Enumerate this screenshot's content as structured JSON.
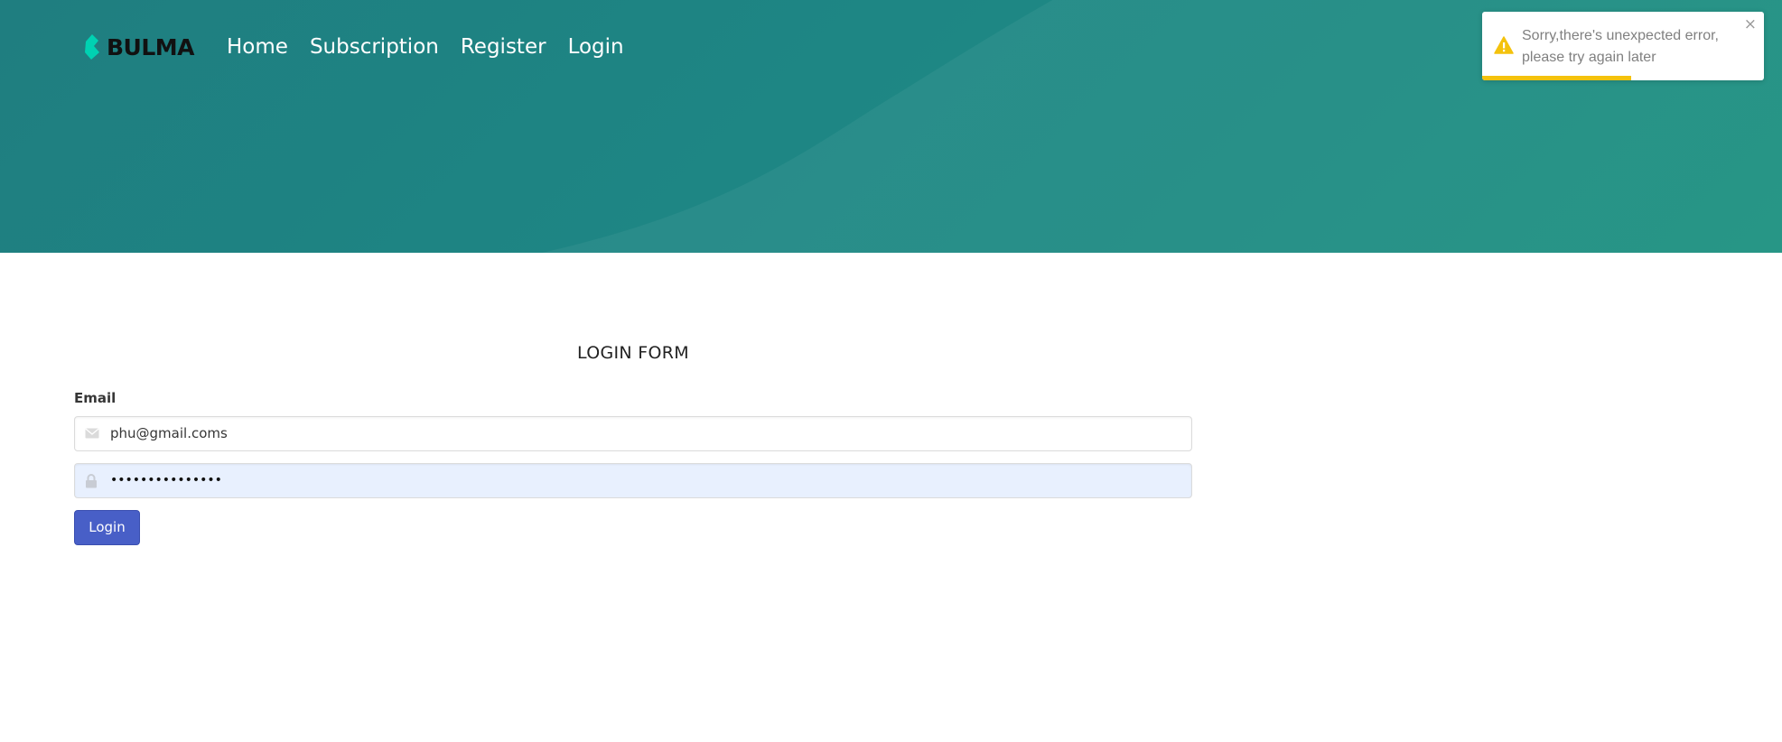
{
  "navbar": {
    "brand": "BULMA",
    "links": [
      "Home",
      "Subscription",
      "Register",
      "Login"
    ]
  },
  "toast": {
    "message": "Sorry,there's unexpected error, please try again later",
    "close": "×",
    "icon": "warning-icon",
    "progress": 0.53,
    "accent": "#f4c20d"
  },
  "form": {
    "title": "LOGIN FORM",
    "email_label": "Email",
    "email_value": "phu@gmail.coms",
    "email_icon": "envelope-icon",
    "password_value": "•••••••••••••••",
    "password_icon": "lock-icon",
    "submit": "Login"
  },
  "colors": {
    "hero": "#1e8684",
    "button": "#485fc7",
    "brand_icon": "#00d1b2"
  }
}
